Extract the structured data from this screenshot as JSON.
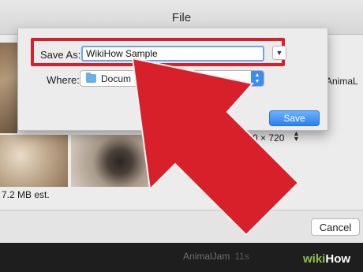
{
  "window": {
    "title": "File"
  },
  "content": {
    "size_estimate": "7.2 MB est.",
    "side_label": "AnimaL",
    "resolution": "1280 × 720"
  },
  "save_sheet": {
    "save_as_label": "Save As:",
    "save_as_value": "WikiHow Sample",
    "where_label": "Where:",
    "where_value": "Docum",
    "where_icon": "folder-icon",
    "save_label": "Save",
    "accent_color": "#3d8cf5"
  },
  "bottom_bar": {
    "cancel_label": "Cancel"
  },
  "strip": {
    "name": "AnimalJam",
    "duration": "11s"
  },
  "overlay": {
    "arrow_color": "#d8202a",
    "highlight_color": "#d8202a"
  },
  "watermark": {
    "wiki": "wiki",
    "how": "How"
  }
}
